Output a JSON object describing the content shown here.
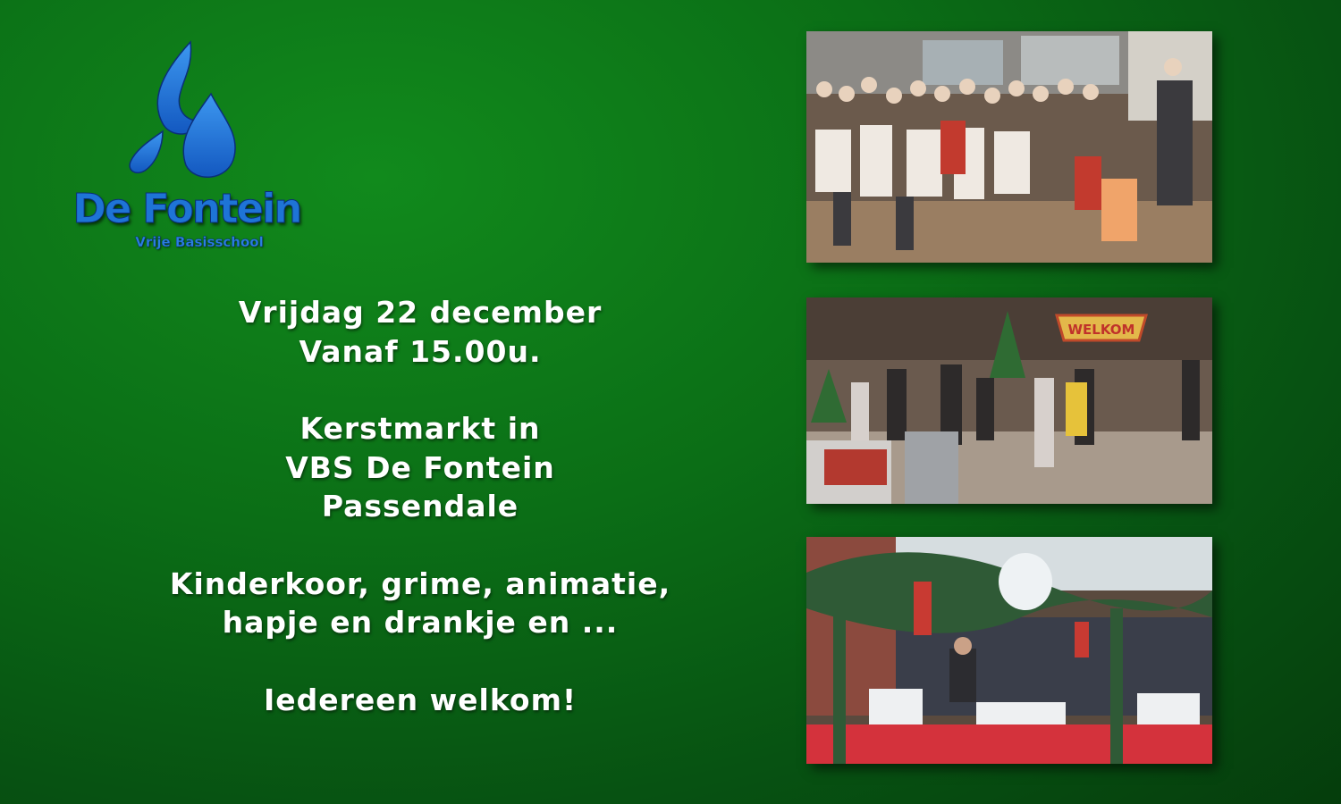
{
  "logo": {
    "title": "De Fontein",
    "subtitle": "Vrije Basisschool",
    "icon": "water-drop-icon",
    "color": "#1e74d6"
  },
  "info": {
    "line1": "Vrijdag 22 december",
    "line2": "Vanaf 15.00u.",
    "line3": "Kerstmarkt in",
    "line4": "VBS De Fontein",
    "line5": "Passendale",
    "line6": "Kinderkoor, grime, animatie,",
    "line7": "hapje en drankje en ...",
    "line8": "Iedereen welkom!"
  },
  "photos": {
    "market_banner": "WELKOM"
  },
  "colors": {
    "background": "#0b6e16",
    "text": "#ffffff"
  }
}
